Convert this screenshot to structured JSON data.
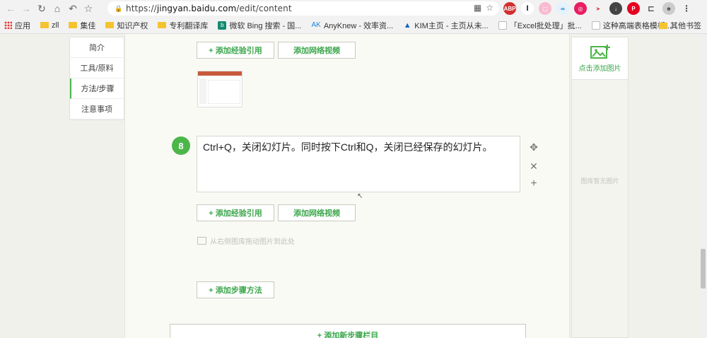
{
  "browser": {
    "url_scheme": "https://",
    "url_host": "jingyan.baidu.com",
    "url_path": "/edit/content"
  },
  "bookmarks": {
    "items": [
      {
        "label": "应用",
        "icon": "apps-grid-icon"
      },
      {
        "label": "zll",
        "icon": "folder-icon"
      },
      {
        "label": "集佳",
        "icon": "folder-icon"
      },
      {
        "label": "知识产权",
        "icon": "folder-icon"
      },
      {
        "label": "专利翻译库",
        "icon": "folder-icon"
      },
      {
        "label": "微软 Bing 搜索 - 国...",
        "icon": "bing-icon"
      },
      {
        "label": "AnyKnew - 效率资...",
        "icon": "anyknew-icon"
      },
      {
        "label": "KIM主页 - 主页从未...",
        "icon": "kim-icon"
      },
      {
        "label": "「Excel批处理」批...",
        "icon": "page-icon"
      },
      {
        "label": "这种高端表格模板...",
        "icon": "page-icon"
      }
    ],
    "other_label": "其他书签"
  },
  "leftnav": {
    "items": [
      {
        "label": "简介"
      },
      {
        "label": "工具/原料"
      },
      {
        "label": "方法/步骤"
      },
      {
        "label": "注意事项"
      }
    ]
  },
  "editor": {
    "add_experience_ref": "+ 添加经验引用",
    "add_web_video": "添加网络视频",
    "step_number": "8",
    "step_text": "Ctrl+Q，关闭幻灯片。同时按下Ctrl和Q，关闭已经保存的幻灯片。",
    "drag_hint": "从右侧图库拖动图片到此处",
    "add_step_method": "+ 添加步骤方法",
    "add_new_section": "+ 添加新步骤栏目"
  },
  "rightpanel": {
    "add_picture_label": "点击添加图片",
    "empty_text": "图库暂无图片"
  },
  "colors": {
    "accent": "#4cb648",
    "link_green": "#3aa64a"
  }
}
